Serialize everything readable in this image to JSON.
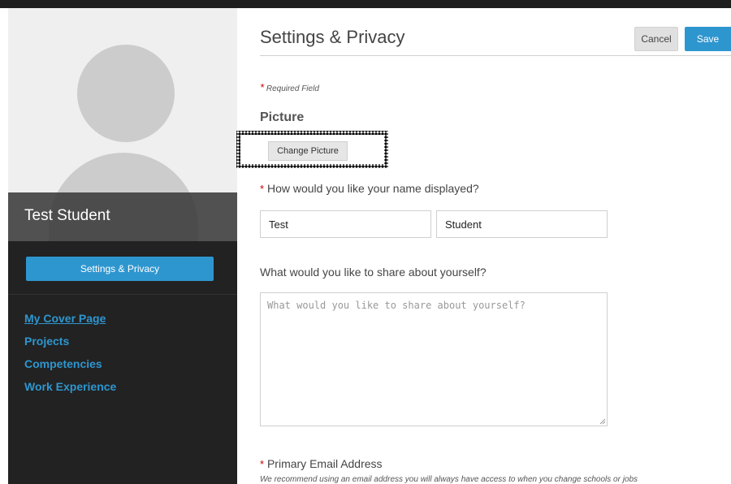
{
  "sidebar": {
    "student_name": "Test Student",
    "settings_button": "Settings & Privacy",
    "nav_items": [
      {
        "label": "My Cover Page"
      },
      {
        "label": "Projects"
      },
      {
        "label": "Competencies"
      },
      {
        "label": "Work Experience"
      }
    ]
  },
  "header": {
    "title": "Settings & Privacy",
    "cancel_label": "Cancel",
    "save_label": "Save"
  },
  "form": {
    "required_star": "*",
    "required_note": "Required Field",
    "picture_heading": "Picture",
    "change_picture_label": "Change Picture",
    "name_question": "How would you like your name displayed?",
    "first_name_value": "Test",
    "last_name_value": "Student",
    "share_question": "What would you like to share about yourself?",
    "share_placeholder": "What would you like to share about yourself?",
    "email_label": "Primary Email Address",
    "email_note": "We recommend using an email address you will always have access to when you change schools or jobs"
  },
  "colors": {
    "accent": "#2e96cf",
    "sidebar_bg": "#222222",
    "required": "#cc0000"
  }
}
